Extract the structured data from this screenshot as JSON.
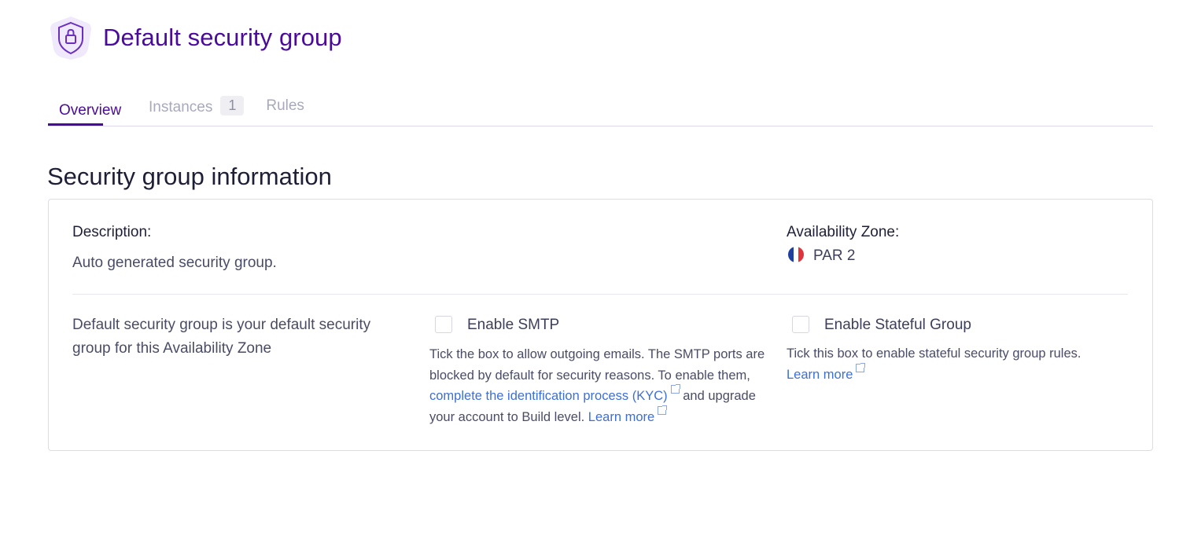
{
  "header": {
    "title": "Default security group",
    "icon": "shield-lock-icon"
  },
  "tabs": [
    {
      "label": "Overview",
      "active": true
    },
    {
      "label": "Instances",
      "count": "1"
    },
    {
      "label": "Rules"
    }
  ],
  "section": {
    "title": "Security group information"
  },
  "card": {
    "description_label": "Description:",
    "description_value": "Auto generated security group.",
    "zone_label": "Availability Zone:",
    "zone_value": "PAR 2",
    "zone_flag": "france-flag-icon",
    "default_text": "Default security group is your default security group for this Availability Zone",
    "smtp": {
      "label": "Enable SMTP",
      "checked": false,
      "help_1": "Tick the box to allow outgoing emails. The SMTP ports are blocked by default for security reasons. To enable them,",
      "link_kyc": "complete the identification process (KYC)",
      "help_2": "and upgrade your account to Build level.",
      "link_learn": "Learn more"
    },
    "stateful": {
      "label": "Enable Stateful Group",
      "checked": false,
      "help": "Tick this box to enable stateful security group rules.",
      "link_learn": "Learn more"
    }
  },
  "colors": {
    "accent": "#4a0a9c",
    "link": "#3d6fd8"
  }
}
